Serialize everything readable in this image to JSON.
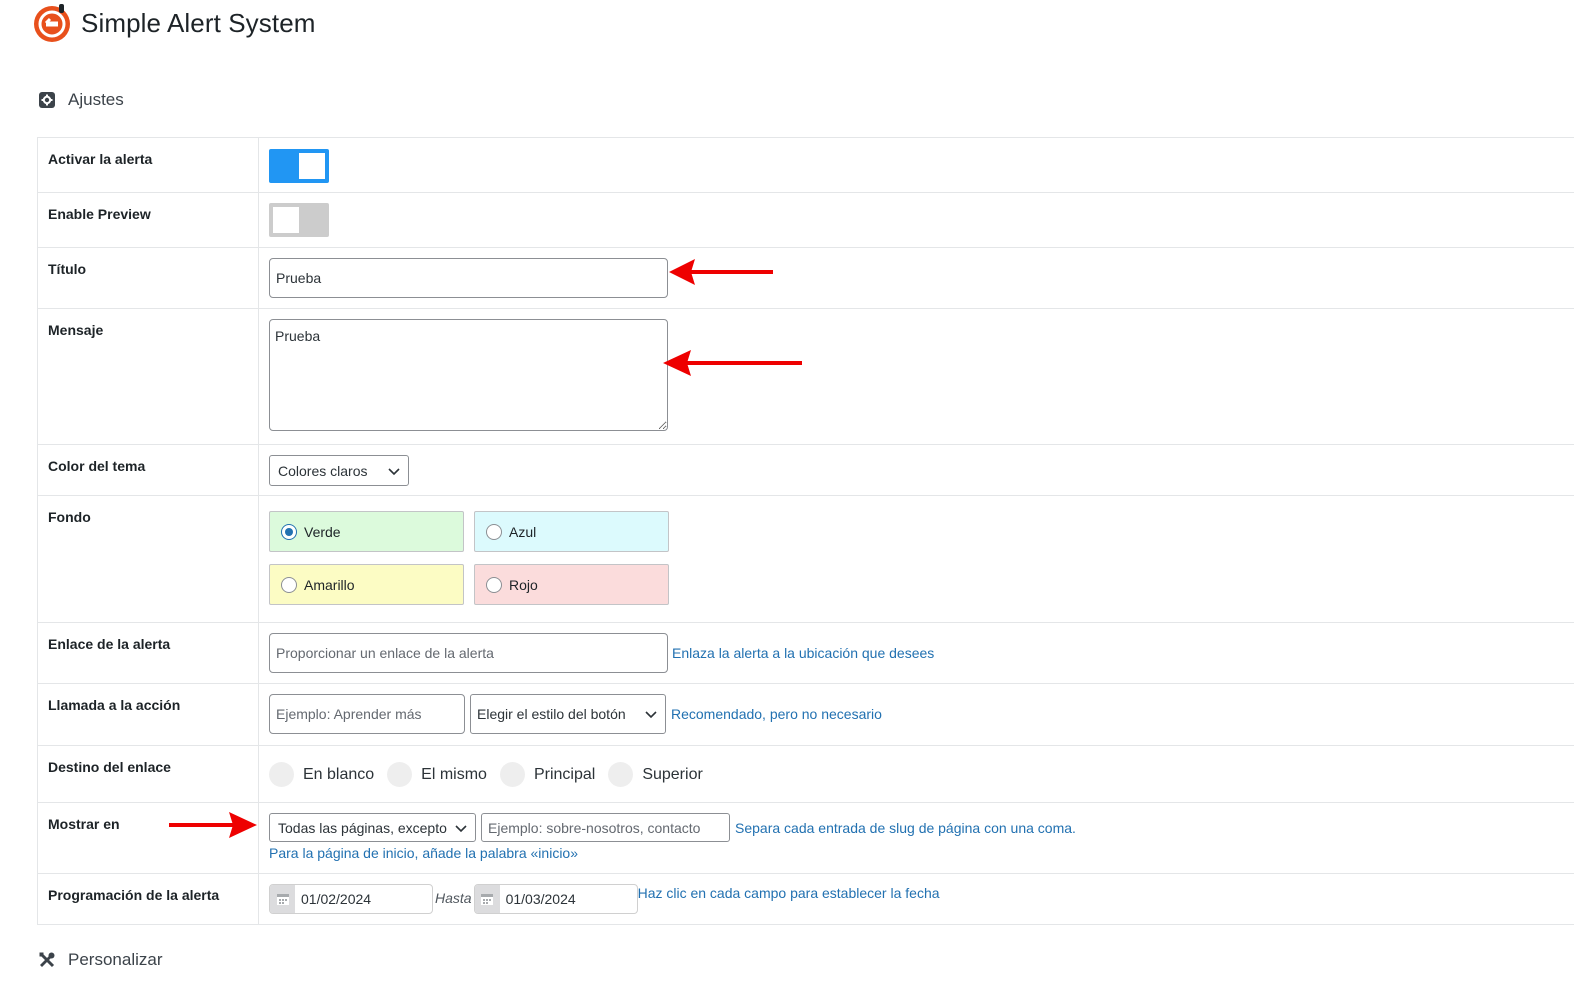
{
  "app": {
    "title": "Simple Alert System"
  },
  "sections": {
    "settings": "Ajustes",
    "customize": "Personalizar"
  },
  "rows": {
    "activate": {
      "label": "Activar la alerta",
      "state": "on"
    },
    "preview": {
      "label": "Enable Preview",
      "state": "off"
    },
    "title": {
      "label": "Título",
      "value": "Prueba"
    },
    "message": {
      "label": "Mensaje",
      "value": "Prueba"
    },
    "theme": {
      "label": "Color del tema",
      "value": "Colores claros"
    },
    "background": {
      "label": "Fondo",
      "options": [
        {
          "label": "Verde",
          "color": "#dcfadc",
          "checked": true
        },
        {
          "label": "Azul",
          "color": "#dcfafd",
          "checked": false
        },
        {
          "label": "Amarillo",
          "color": "#fcfcc4",
          "checked": false
        },
        {
          "label": "Rojo",
          "color": "#fbdcdc",
          "checked": false
        }
      ]
    },
    "link": {
      "label": "Enlace de la alerta",
      "placeholder": "Proporcionar un enlace de la alerta",
      "help": "Enlaza la alerta a la ubicación que desees"
    },
    "cta": {
      "label": "Llamada a la acción",
      "placeholder": "Ejemplo: Aprender más",
      "style_select": "Elegir el estilo del botón",
      "help": "Recomendado, pero no necesario"
    },
    "target": {
      "label": "Destino del enlace",
      "options": [
        "En blanco",
        "El mismo",
        "Principal",
        "Superior"
      ]
    },
    "show_on": {
      "label": "Mostrar en",
      "select": "Todas las páginas, excepto",
      "placeholder": "Ejemplo: sobre-nosotros, contacto",
      "help": "Separa cada entrada de slug de página con una coma.",
      "help2": "Para la página de inicio, añade la palabra «inicio»"
    },
    "schedule": {
      "label": "Programación de la alerta",
      "from": "01/02/2024",
      "to_label": "Hasta",
      "to": "01/03/2024",
      "help": "Haz clic en cada campo para establecer la fecha"
    }
  },
  "colors": {
    "accent": "#2196f3",
    "link": "#2271b1",
    "arrow": "#ee0000",
    "logo": "#e8501c"
  }
}
